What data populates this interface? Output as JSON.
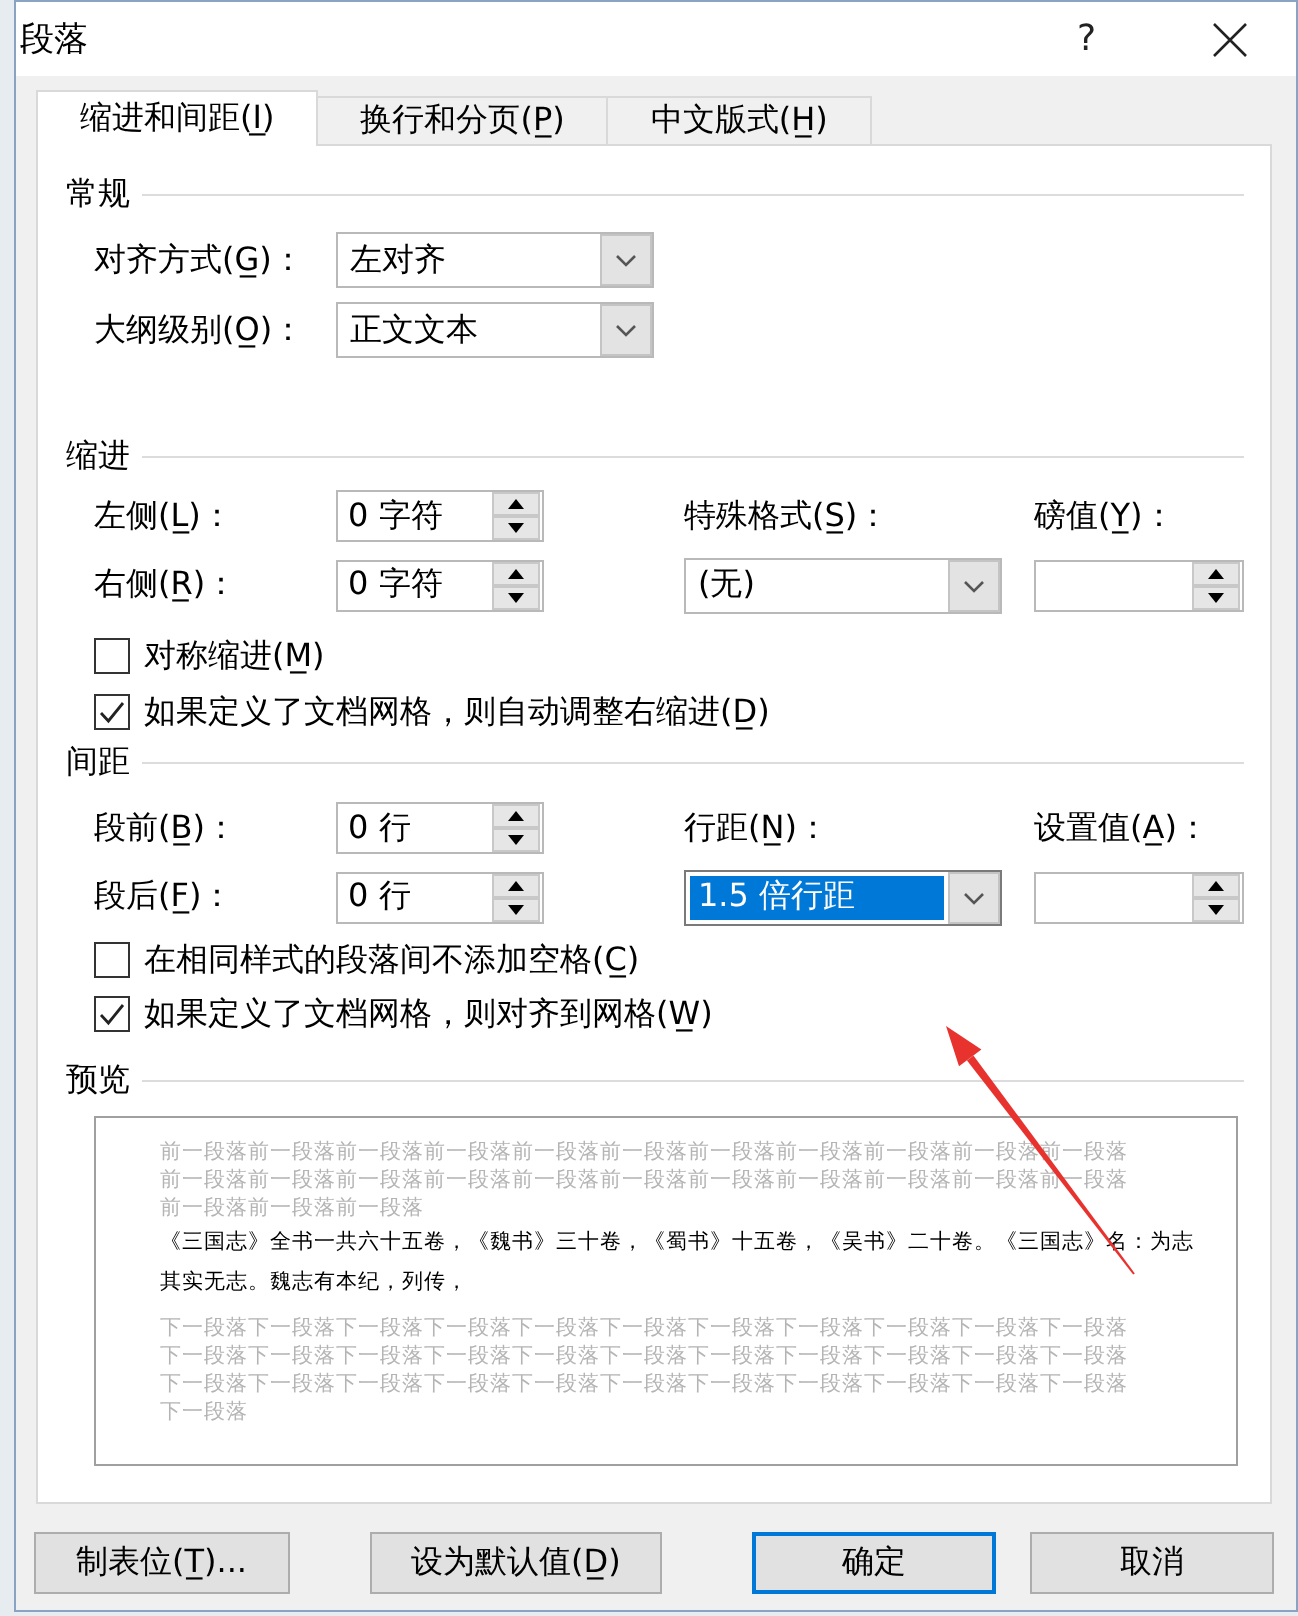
{
  "window": {
    "title": "段落",
    "help_button": "?"
  },
  "tabs": [
    {
      "label": "缩进和间距(I̲)",
      "selected": true
    },
    {
      "label": "换行和分页(P̲)",
      "selected": false
    },
    {
      "label": "中文版式(H̲)",
      "selected": false
    }
  ],
  "general": {
    "heading": "常规",
    "fields": [
      {
        "label": "对齐方式(G̲)：",
        "value": "左对齐",
        "focused": false
      },
      {
        "label": "大纲级别(O̲)：",
        "value": "正文文本",
        "focused": false
      }
    ]
  },
  "indent": {
    "heading": "缩进",
    "left": {
      "label": "左侧(L̲)：",
      "value": "0 字符"
    },
    "right": {
      "label": "右侧(R̲)：",
      "value": "0 字符"
    },
    "special": {
      "label": "特殊格式(S̲)：",
      "value": "(无)",
      "focused": false
    },
    "by": {
      "label": "磅值(Y̲)："
    },
    "checkboxes": [
      {
        "label": "对称缩进(M̲)",
        "checked": false
      },
      {
        "label": "如果定义了文档网格，则自动调整右缩进(D̲)",
        "checked": true
      }
    ]
  },
  "spacing": {
    "heading": "间距",
    "before": {
      "label": "段前(B̲)：",
      "value": "0 行"
    },
    "after": {
      "label": "段后(F̲)：",
      "value": "0 行"
    },
    "line_spacing": {
      "label": "行距(N̲)：",
      "value": "1.5 倍行距",
      "focused": true
    },
    "at": {
      "label": "设置值(A̲)："
    },
    "checkboxes": [
      {
        "label": "在相同样式的段落间不添加空格(C̲)",
        "checked": false
      },
      {
        "label": "如果定义了文档网格，则对齐到网格(W̲)",
        "checked": true
      }
    ]
  },
  "preview": {
    "heading": "预览",
    "preceding_lines": [
      "前一段落前一段落前一段落前一段落前一段落前一段落前一段落前一段落前一段落前一段落前一段落",
      "前一段落前一段落前一段落前一段落前一段落前一段落前一段落前一段落前一段落前一段落前一段落",
      "前一段落前一段落前一段落"
    ],
    "sample_lines": [
      "《三国志》全书一共六十五卷，《魏书》三十卷，《蜀书》十五卷，《吴书》二十卷。《三国志》名：为志",
      "其实无志。魏志有本纪，列传，"
    ],
    "following_lines": [
      "下一段落下一段落下一段落下一段落下一段落下一段落下一段落下一段落下一段落下一段落下一段落",
      "下一段落下一段落下一段落下一段落下一段落下一段落下一段落下一段落下一段落下一段落下一段落",
      "下一段落下一段落下一段落下一段落下一段落下一段落下一段落下一段落下一段落下一段落下一段落",
      "下一段落"
    ]
  },
  "buttons": [
    {
      "label": "制表位(T̲)...",
      "default": false
    },
    {
      "label": "设为默认值(D̲)",
      "default": false
    },
    {
      "label": "确定",
      "default": true
    },
    {
      "label": "取消",
      "default": false
    }
  ]
}
